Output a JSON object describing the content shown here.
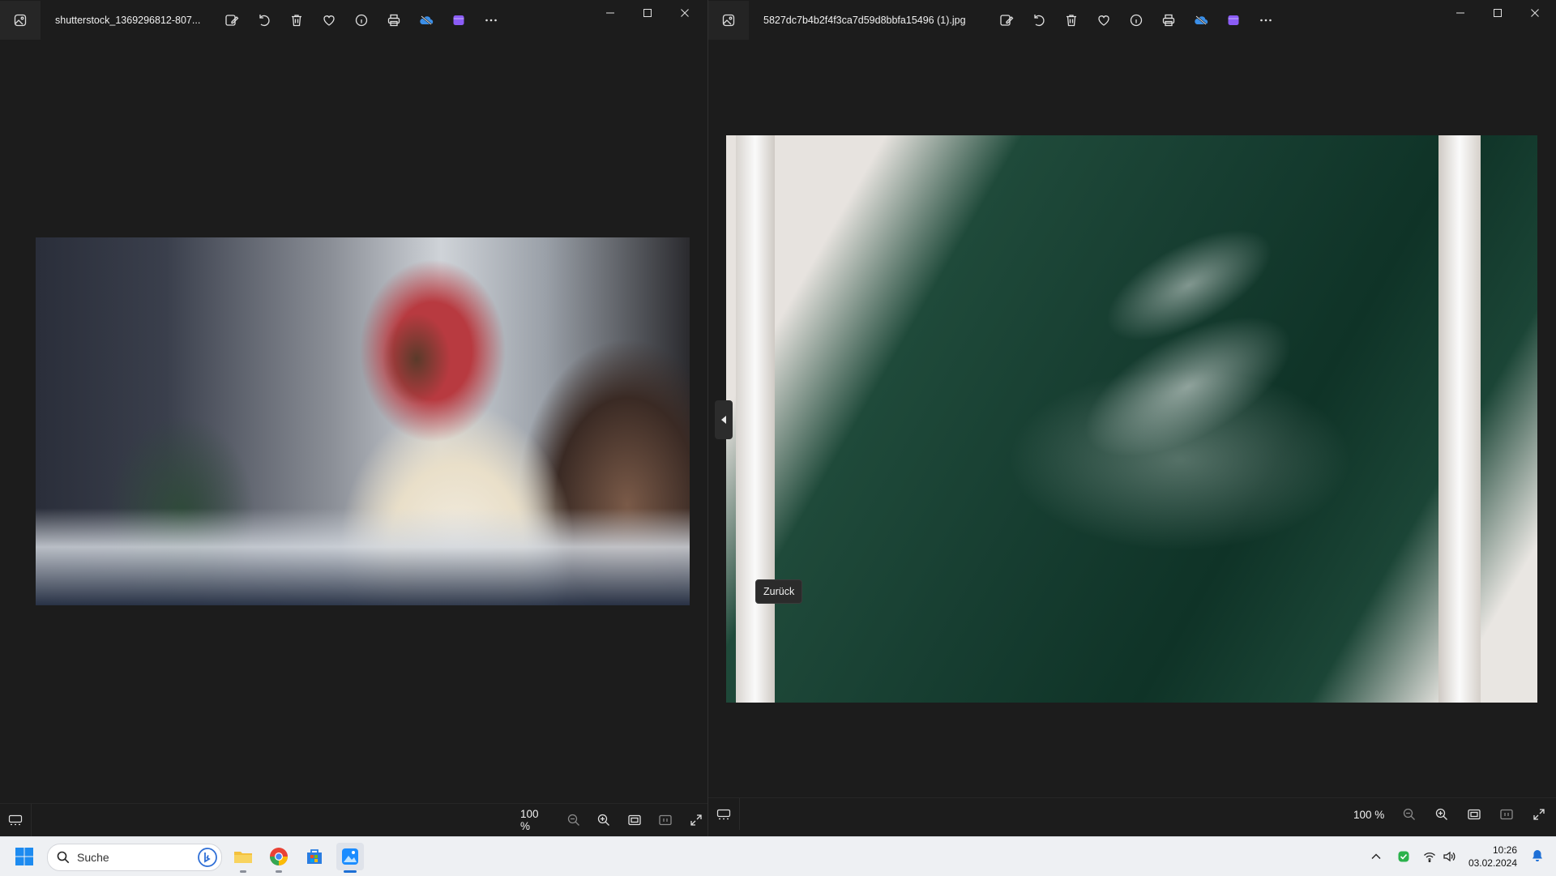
{
  "left_window": {
    "title": "shutterstock_1369296812-807...",
    "zoom": "100 %",
    "toolbar_icons": [
      "edit-icon",
      "rotate-icon",
      "delete-icon",
      "favorite-icon",
      "info-icon",
      "print-icon",
      "onedrive-icon",
      "clipchamp-icon",
      "more-icon"
    ]
  },
  "right_window": {
    "title": "5827dc7b4b2f4f3ca7d59d8bbfa15496 (1).jpg",
    "zoom": "100 %",
    "tooltip": "Zurück"
  },
  "taskbar": {
    "search_label": "Suche",
    "time": "10:26",
    "date": "03.02.2024"
  },
  "colors": {
    "window_bg": "#1c1c1c",
    "taskbar_bg": "#eef0f3",
    "accent": "#1d6fd6",
    "onedrive": "#3b8fe8",
    "clipchamp": "#8b5cf6"
  }
}
